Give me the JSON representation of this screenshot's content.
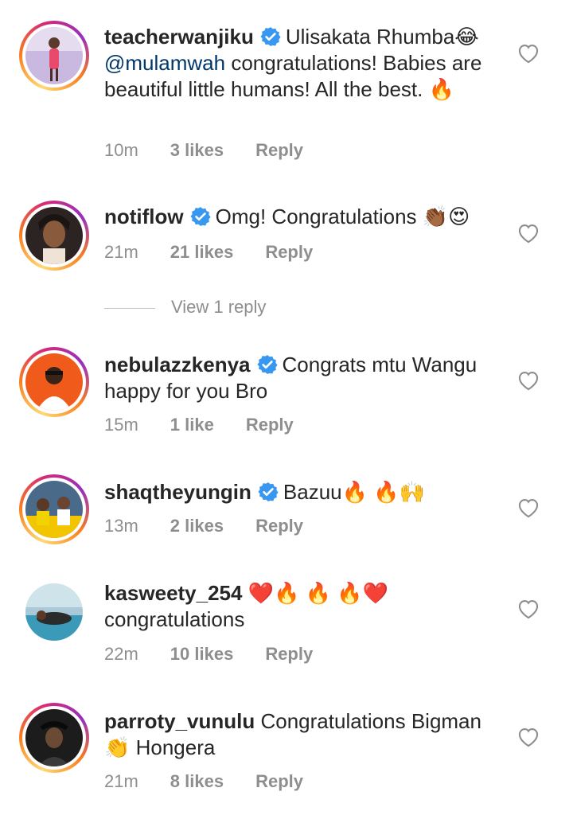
{
  "comments": [
    {
      "username": "teacherwanjiku",
      "verified": true,
      "text_pre": "Ulisakata Rhumba😂",
      "mention": "@mulamwah",
      "text_post": " congratulations! Babies are beautiful little humans! All the best. 🔥",
      "time": "10m",
      "likes": "3 likes",
      "reply": "Reply"
    },
    {
      "username": "notiflow",
      "verified": true,
      "text": "Omg! Congratulations 👏🏾😍",
      "time": "21m",
      "likes": "21 likes",
      "reply": "Reply"
    },
    {
      "username": "nebulazzkenya",
      "verified": true,
      "text": "Congrats mtu Wangu happy for you Bro",
      "time": "15m",
      "likes": "1 like",
      "reply": "Reply"
    },
    {
      "username": "shaqtheyungin",
      "verified": true,
      "text": "Bazuu🔥 🔥🙌",
      "time": "13m",
      "likes": "2 likes",
      "reply": "Reply"
    },
    {
      "username": "kasweety_254",
      "verified": false,
      "text": "❤️🔥 🔥 🔥❤️ congratulations",
      "time": "22m",
      "likes": "10 likes",
      "reply": "Reply"
    },
    {
      "username": "parroty_vunulu",
      "verified": false,
      "text": "Congratulations Bigman 👏 Hongera",
      "time": "21m",
      "likes": "8 likes",
      "reply": "Reply"
    }
  ],
  "view_replies": "View 1 reply",
  "icons": {
    "verified": "verified-badge-icon",
    "like": "heart-icon"
  },
  "colors": {
    "verified_blue": "#3897f0",
    "meta_gray": "#8e8e8e",
    "mention_blue": "#00376b"
  }
}
